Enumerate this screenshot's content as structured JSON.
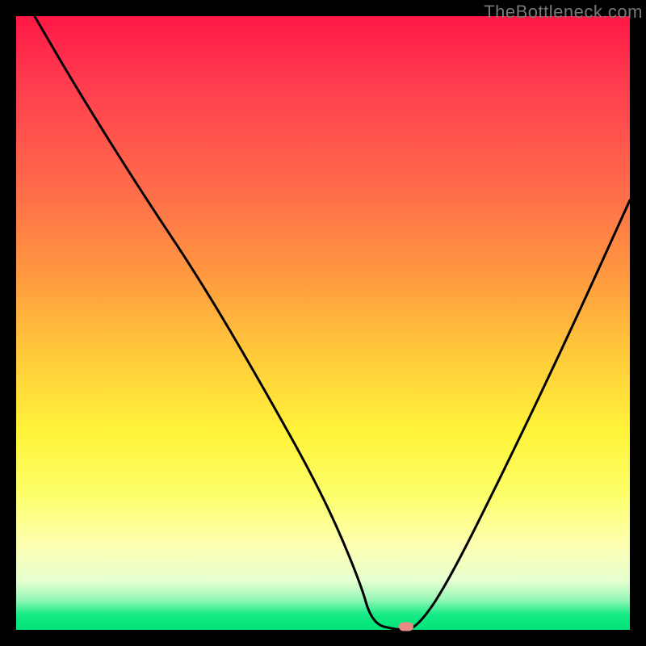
{
  "watermark": "TheBottleneck.com",
  "chart_data": {
    "type": "line",
    "title": "",
    "xlabel": "",
    "ylabel": "",
    "xlim": [
      0,
      100
    ],
    "ylim": [
      0,
      100
    ],
    "grid": false,
    "legend": false,
    "series": [
      {
        "name": "bottleneck-curve",
        "x": [
          3,
          10,
          20,
          30,
          40,
          50,
          56,
          58,
          62,
          65,
          70,
          80,
          90,
          100
        ],
        "y": [
          100,
          88,
          72,
          57,
          40,
          22,
          8,
          1,
          0,
          0,
          7,
          27,
          48,
          70
        ]
      }
    ],
    "marker": {
      "x": 63.5,
      "y": 0.5,
      "color": "#e88a86"
    },
    "gradient_stops": [
      {
        "pos": 0.0,
        "color": "#ff1846"
      },
      {
        "pos": 0.28,
        "color": "#ff6b4a"
      },
      {
        "pos": 0.55,
        "color": "#ffc93a"
      },
      {
        "pos": 0.78,
        "color": "#fdff6a"
      },
      {
        "pos": 0.92,
        "color": "#e6ffd0"
      },
      {
        "pos": 0.975,
        "color": "#17eb85"
      },
      {
        "pos": 1.0,
        "color": "#00e37a"
      }
    ]
  }
}
